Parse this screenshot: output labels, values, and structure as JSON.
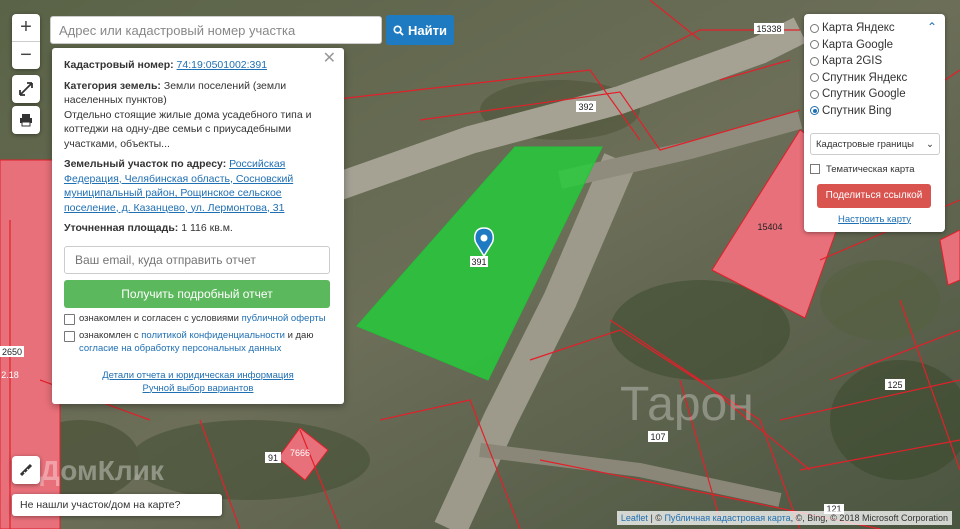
{
  "search": {
    "placeholder": "Адрес или кадастровый номер участка",
    "button_label": "Найти"
  },
  "zoom": {
    "plus": "+",
    "minus": "−"
  },
  "icons": {
    "search": "search-icon",
    "fullscreen": "fullscreen-icon",
    "print": "print-icon",
    "ruler": "ruler-icon",
    "pin": "map-pin-icon",
    "close": "close-icon"
  },
  "popup": {
    "cadastral_label": "Кадастровый номер:",
    "cadastral_value": "74:19:0501002:391",
    "category_label": "Категория земель:",
    "category_value": "Земли поселений (земли населенных пунктов)",
    "description": "Отдельно стоящие жилые дома усадебного типа и коттеджи на одну-две семьи с приусадебными участками, объекты...",
    "address_label": "Земельный участок по адресу:",
    "address_value": "Российская Федерация, Челябинская область, Сосновский муниципальный район, Рощинское сельское поселение, д. Казанцево, ул. Лермонтова, 31",
    "area_label": "Уточненная площадь:",
    "area_value": "1 116 кв.м.",
    "email_placeholder": "Ваш email, куда отправить отчет",
    "report_button": "Получить подробный отчет",
    "consent1_text": "ознакомлен и согласен с условиями",
    "consent1_link": "публичной оферты",
    "consent2_text": "ознакомлен с",
    "consent2_link": "политикой конфиденциальности",
    "consent2_mid": "и даю",
    "consent2_link2": "согласие на обработку персональных данных",
    "details_link": "Детали отчета и юридическая информация",
    "manual_link": "Ручной выбор вариантов"
  },
  "layers": {
    "options": [
      {
        "label": "Карта Яндекс",
        "selected": false
      },
      {
        "label": "Карта Google",
        "selected": false
      },
      {
        "label": "Карта 2GIS",
        "selected": false
      },
      {
        "label": "Спутник Яндекс",
        "selected": false
      },
      {
        "label": "Спутник Google",
        "selected": false
      },
      {
        "label": "Спутник Bing",
        "selected": true
      }
    ],
    "select_value": "Кадастровые границы",
    "thematic_label": "Тематическая карта",
    "share_button": "Поделиться ссылкой",
    "configure_link": "Настроить карту"
  },
  "map_labels": {
    "l392": "392",
    "l391": "391",
    "l15338": "15338",
    "l15404": "15404",
    "l2650": "2650",
    "l218": "2.18",
    "l125": "125",
    "l107": "107",
    "l91": "91",
    "l7666": "7666",
    "l121": "121",
    "watermark1": "ДомКлик",
    "watermark2": "Тарон"
  },
  "bottom_note": "Не нашли участок/дом на карте?",
  "attribution": {
    "leaflet": "Leaflet",
    "sep": "|",
    "copy": "©",
    "pkk": "Публичная кадастровая карта",
    "rest": ", ©, Bing, © 2018 Microsoft Corporation"
  },
  "colors": {
    "parcel": "#22d13a",
    "boundary": "#e2202a",
    "building": "#e8707a",
    "accent": "#1f6fb3"
  }
}
